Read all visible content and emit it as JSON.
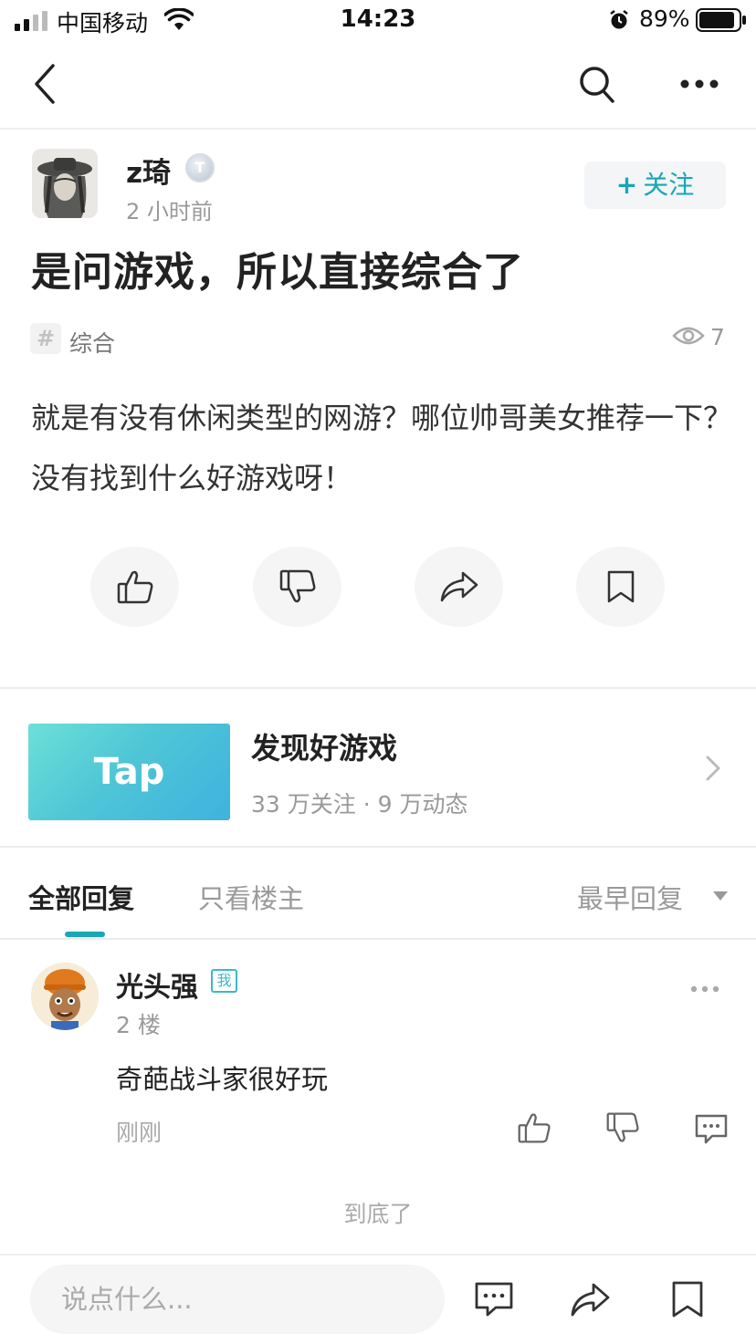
{
  "status_bar": {
    "carrier": "中国移动",
    "time": "14:23",
    "battery": "89%"
  },
  "nav": {
    "back_icon": "chevron-left-icon",
    "search_icon": "search-icon",
    "more_icon": "more-horizontal-icon"
  },
  "post": {
    "author": {
      "name": "z琦",
      "badge": "T",
      "time": "2 小时前"
    },
    "follow_label": "关注",
    "title": "是问游戏，所以直接综合了",
    "tag": "综合",
    "views": "7",
    "body": "就是有没有休闲类型的网游？哪位帅哥美女推荐一下？没有找到什么好游戏呀！"
  },
  "game_card": {
    "banner_text": "Tap",
    "title": "发现好游戏",
    "stats": "33 万关注 · 9 万动态"
  },
  "tabs": {
    "all_replies": "全部回复",
    "op_only": "只看楼主",
    "sort": "最早回复"
  },
  "reply": {
    "name": "光头强",
    "me_badge": "我",
    "floor": "2 楼",
    "text": "奇葩战斗家很好玩",
    "time": "刚刚"
  },
  "end_text": "到底了",
  "bottom_bar": {
    "input_placeholder": "说点什么..."
  },
  "colors": {
    "accent": "#17a7b5",
    "banner_start": "#6ce0d8",
    "banner_end": "#3fb2df"
  }
}
